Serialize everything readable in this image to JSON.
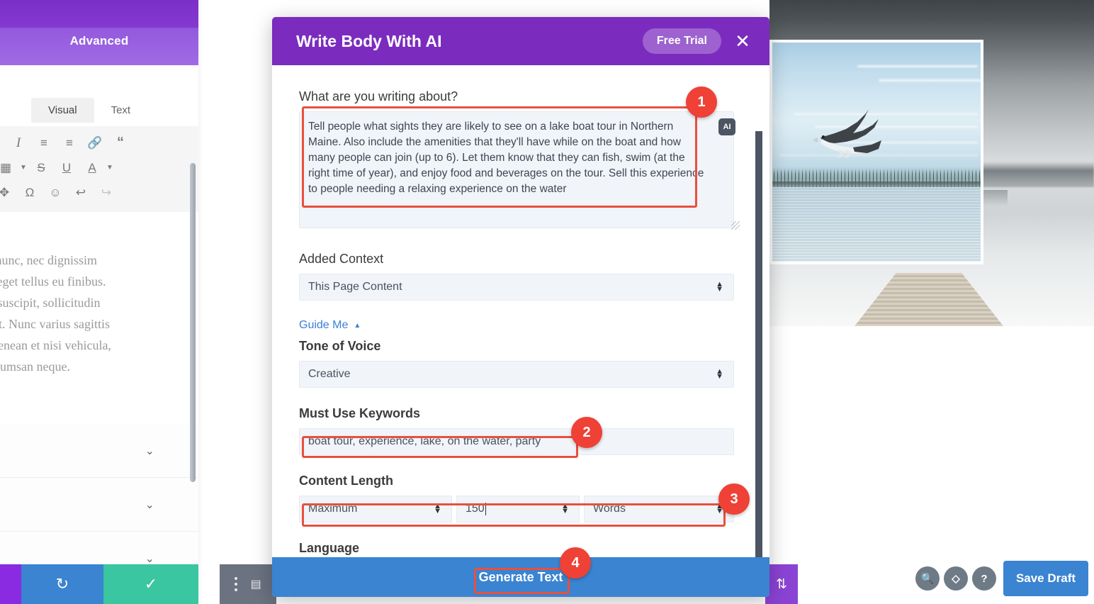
{
  "editor_panel": {
    "header_tab": "Advanced",
    "tabs": [
      {
        "label": "Visual",
        "state": "active"
      },
      {
        "label": "Text",
        "state": "inactive"
      }
    ],
    "toolbar_icons": [
      "italic-icon",
      "bullet-list-icon",
      "numbered-list-icon",
      "link-icon",
      "blockquote-icon",
      "table-icon",
      "strikethrough-icon",
      "underline-icon",
      "text-color-icon",
      "dropdown-caret-icon",
      "fullscreen-icon",
      "special-character-icon",
      "emoji-icon",
      "undo-icon",
      "redo-icon"
    ],
    "body_lines": [
      "t nunc, nec dignissim",
      "s eget tellus eu finibus.",
      "e suscipit, sollicitudin",
      "rat. Nunc varius sagittis",
      "Aenean et nisi vehicula,",
      "ccumsan neque."
    ],
    "footer": {
      "purple": "",
      "redo_icon": "redo-icon",
      "save_icon": "checkmark-icon"
    }
  },
  "divi_bottom_bar": {
    "icons": [
      "search-icon",
      "layers-icon",
      "help-icon"
    ],
    "save_draft_label": "Save Draft"
  },
  "modal": {
    "title": "Write Body With AI",
    "free_trial_label": "Free Trial",
    "close_icon": "close-icon",
    "prompt": {
      "label": "What are you writing about?",
      "value": "Tell people what sights they are likely to see on a lake boat tour in Northern Maine. Also include the amenities that they'll have while on the boat and how many people can join (up to 6). Let them know that they can fish, swim (at the right time of year), and enjoy food and beverages on the tour. Sell this experience to people needing a relaxing experience on the water",
      "badge_icon": "ai-icon",
      "badge_label": "AI"
    },
    "added_context": {
      "label": "Added Context",
      "value": "This Page Content"
    },
    "guide_me": {
      "label": "Guide Me",
      "caret": "collapse-caret-icon"
    },
    "tone_of_voice": {
      "label": "Tone of Voice",
      "value": "Creative"
    },
    "must_use_keywords": {
      "label": "Must Use Keywords",
      "value": "boat tour, experience, lake, on the water, party"
    },
    "content_length": {
      "label": "Content Length",
      "mode": "Maximum",
      "amount": "150",
      "unit": "Words"
    },
    "language": {
      "label": "Language"
    },
    "footer": {
      "generate_label": "Generate Text",
      "left_icons": [
        "more-options-icon",
        "layout-icon"
      ],
      "right_icon": "sort-arrows-icon"
    }
  },
  "annotations": [
    {
      "number": "1",
      "target": "prompt-textarea"
    },
    {
      "number": "2",
      "target": "keywords-input"
    },
    {
      "number": "3",
      "target": "content-length-row"
    },
    {
      "number": "4",
      "target": "generate-text-button"
    }
  ],
  "colors": {
    "modal_header_purple": "#7b2cbf",
    "primary_blue": "#3a84d1",
    "annotation_red": "#ef4136",
    "field_bg": "#f1f4f9",
    "link_blue": "#3b7dd8"
  }
}
